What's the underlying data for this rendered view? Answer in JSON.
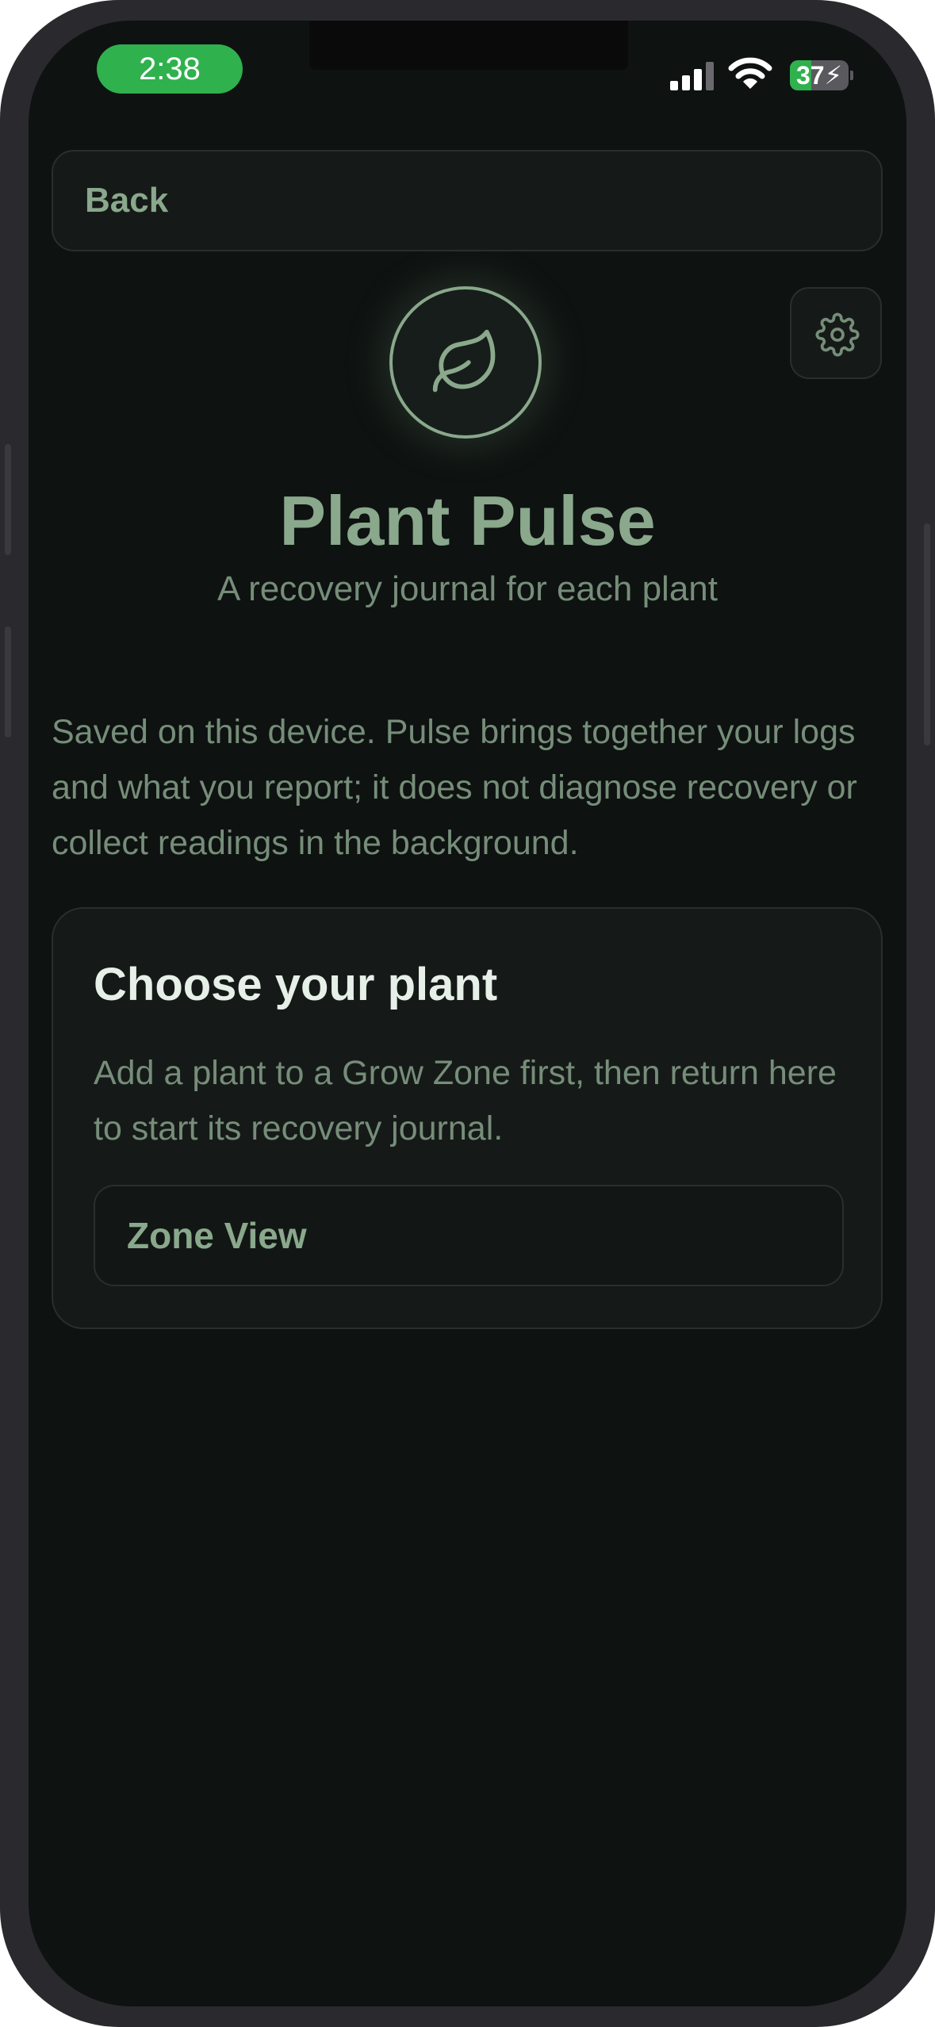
{
  "status_bar": {
    "time": "2:38",
    "battery_percent": "37",
    "battery_level": 0.37,
    "charging": true,
    "icons": [
      "cellular-signal-icon",
      "wifi-icon",
      "battery-charging-icon"
    ]
  },
  "nav": {
    "back_label": "Back",
    "settings_icon": "gear-icon"
  },
  "hero": {
    "icon": "leaf-icon",
    "title": "Plant Pulse",
    "subtitle": "A recovery journal for each plant"
  },
  "info_text": "Saved on this device. Pulse brings together your logs and what you report; it does not diagnose recovery or collect readings in the background.",
  "choose_card": {
    "title": "Choose your plant",
    "description": "Add a plant to a Grow Zone first, then return here to start its recovery journal.",
    "button_label": "Zone View"
  },
  "colors": {
    "background": "#0e1211",
    "accent": "#8aa88c",
    "muted_text": "#768d79",
    "card": "#151a18",
    "status_green": "#2fb14e"
  }
}
